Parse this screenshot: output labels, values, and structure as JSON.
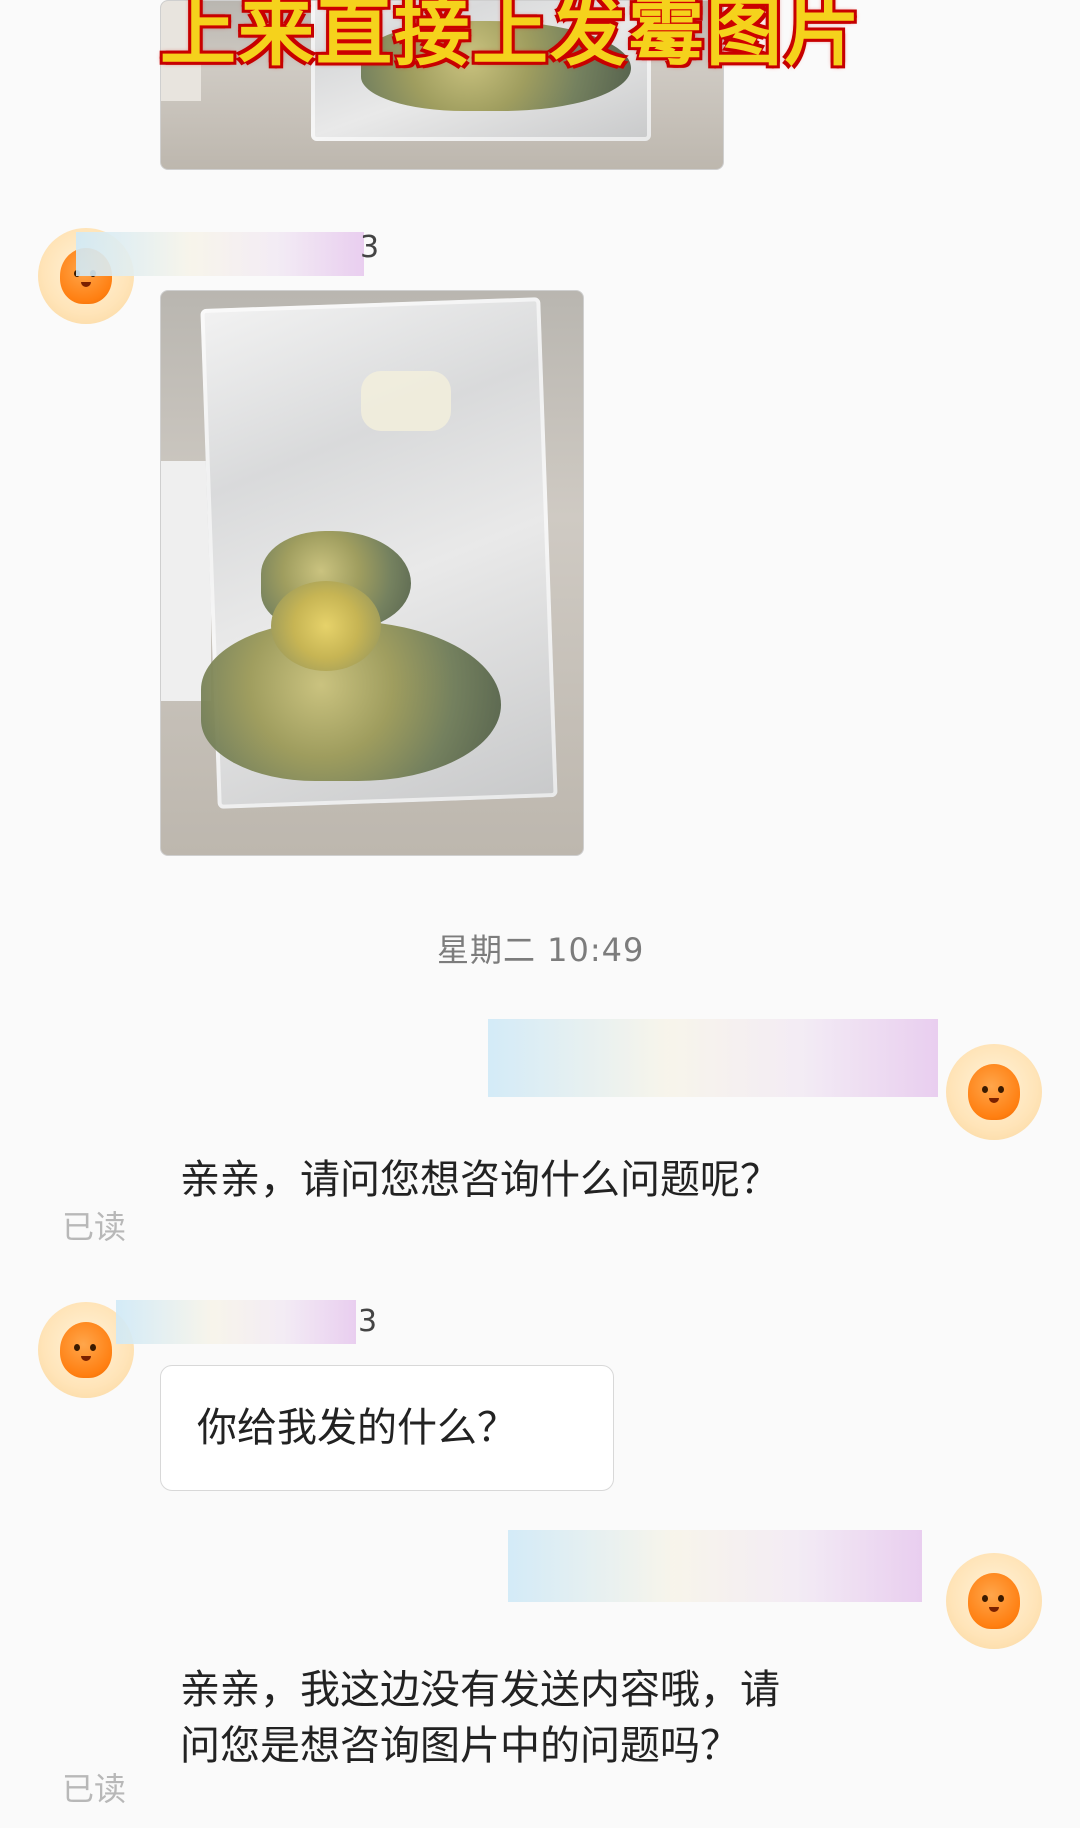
{
  "overlay": {
    "title": "上来直接上发霉图片"
  },
  "chat": {
    "timestamp": "星期二 10:49",
    "sender_suffix_1": "3",
    "sender_suffix_2": "3",
    "reply_1": "亲亲，请问您想咨询什么问题呢？",
    "read_1": "已读",
    "customer_msg": "你给我发的什么？",
    "reply_2_line1": "亲亲，我这边没有发送内容哦，请",
    "reply_2_line2": "问您是想咨询图片中的问题吗？",
    "read_2": "已读"
  }
}
